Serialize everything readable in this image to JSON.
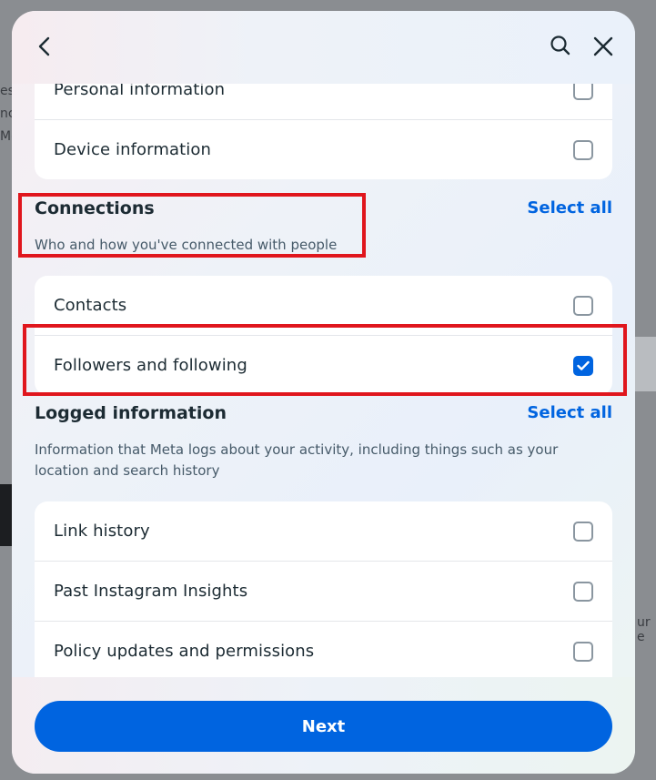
{
  "background": {
    "fragments": [
      "es",
      "nc",
      "Me",
      "ur e"
    ]
  },
  "modal": {
    "header": {
      "back_icon": "chevron-left-icon",
      "search_icon": "search-icon",
      "close_icon": "close-icon"
    },
    "top_card": {
      "items": [
        {
          "label": "Personal information",
          "checked": false
        },
        {
          "label": "Device information",
          "checked": false
        }
      ]
    },
    "connections": {
      "title": "Connections",
      "description": "Who and how you've connected with people",
      "select_all": "Select all",
      "items": [
        {
          "label": "Contacts",
          "checked": false
        },
        {
          "label": "Followers and following",
          "checked": true
        }
      ]
    },
    "logged_information": {
      "title": "Logged information",
      "description_line1": "Information that Meta logs about your activity, including things such as your",
      "description_line2": "location and search history",
      "select_all": "Select all",
      "items": [
        {
          "label": "Link history",
          "checked": false
        },
        {
          "label": "Past Instagram Insights",
          "checked": false
        },
        {
          "label": "Policy updates and permissions",
          "checked": false
        }
      ]
    },
    "footer": {
      "next_label": "Next"
    },
    "colors": {
      "accent": "#0064e0",
      "highlight": "#e0161d",
      "text": "#1c2b33"
    }
  }
}
